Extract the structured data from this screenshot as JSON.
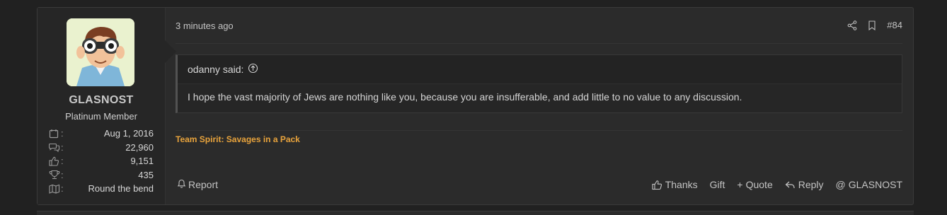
{
  "post": {
    "time": "3 minutes ago",
    "number": "#84",
    "quote": {
      "author": "odanny said:",
      "text": "I hope the vast majority of Jews are nothing like you, because you are insufferable, and add little to no value to any discussion."
    },
    "signature": "Team Spirit: Savages in a Pack",
    "report_label": "Report",
    "actions": {
      "thanks": "Thanks",
      "gift": "Gift",
      "quote": "Quote",
      "reply": "Reply",
      "mention": "GLASNOST"
    }
  },
  "user": {
    "name": "GLASNOST",
    "title": "Platinum Member",
    "stats": [
      {
        "icon": "calendar-icon",
        "value": "Aug 1, 2016"
      },
      {
        "icon": "messages-icon",
        "value": "22,960"
      },
      {
        "icon": "thumbs-up-icon",
        "value": "9,151"
      },
      {
        "icon": "trophy-icon",
        "value": "435"
      },
      {
        "icon": "map-icon",
        "value": "Round the bend"
      }
    ]
  },
  "colors": {
    "page_bg": "#212121",
    "post_bg": "#2b2b2b",
    "signature": "#e8a33c"
  }
}
